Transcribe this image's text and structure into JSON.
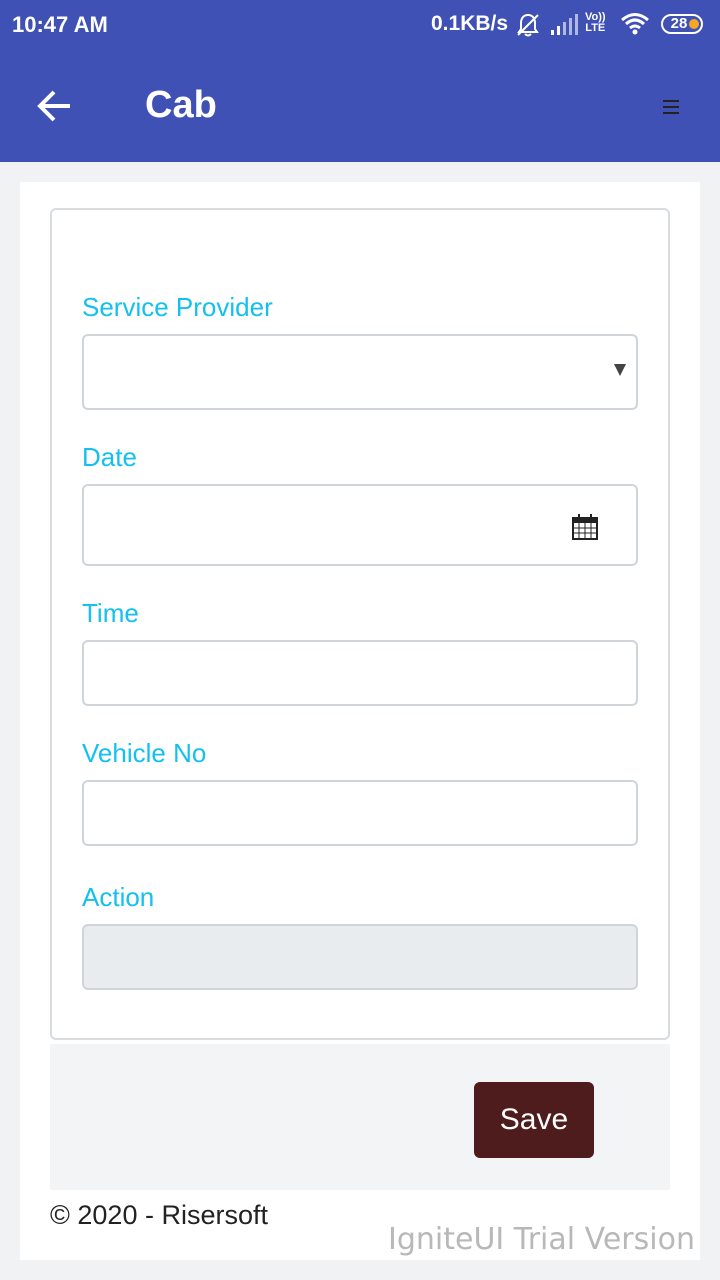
{
  "status_bar": {
    "time": "10:47 AM",
    "network_speed": "0.1KB/s",
    "volte_top": "Vo))",
    "volte_bottom": "LTE",
    "battery": "28",
    "icons": [
      "bell-muted-icon",
      "signal-icon",
      "volte-icon",
      "wifi-icon",
      "battery-icon"
    ]
  },
  "app_bar": {
    "title": "Cab",
    "back_icon": "arrow-left-icon",
    "menu_icon": "hamburger-menu-icon",
    "color": "#3f51b5"
  },
  "form": {
    "fields": [
      {
        "label": "Service Provider",
        "type": "select",
        "value": ""
      },
      {
        "label": "Date",
        "type": "date",
        "value": ""
      },
      {
        "label": "Time",
        "type": "text",
        "value": ""
      },
      {
        "label": "Vehicle No",
        "type": "text",
        "value": ""
      },
      {
        "label": "Action",
        "type": "text",
        "value": "",
        "disabled": true
      }
    ],
    "label_color": "#13c0ef"
  },
  "save_label": "Save",
  "save_color": "#4e1c1c",
  "copyright": "© 2020 - Risersoft",
  "watermark": "IgniteUI Trial Version"
}
